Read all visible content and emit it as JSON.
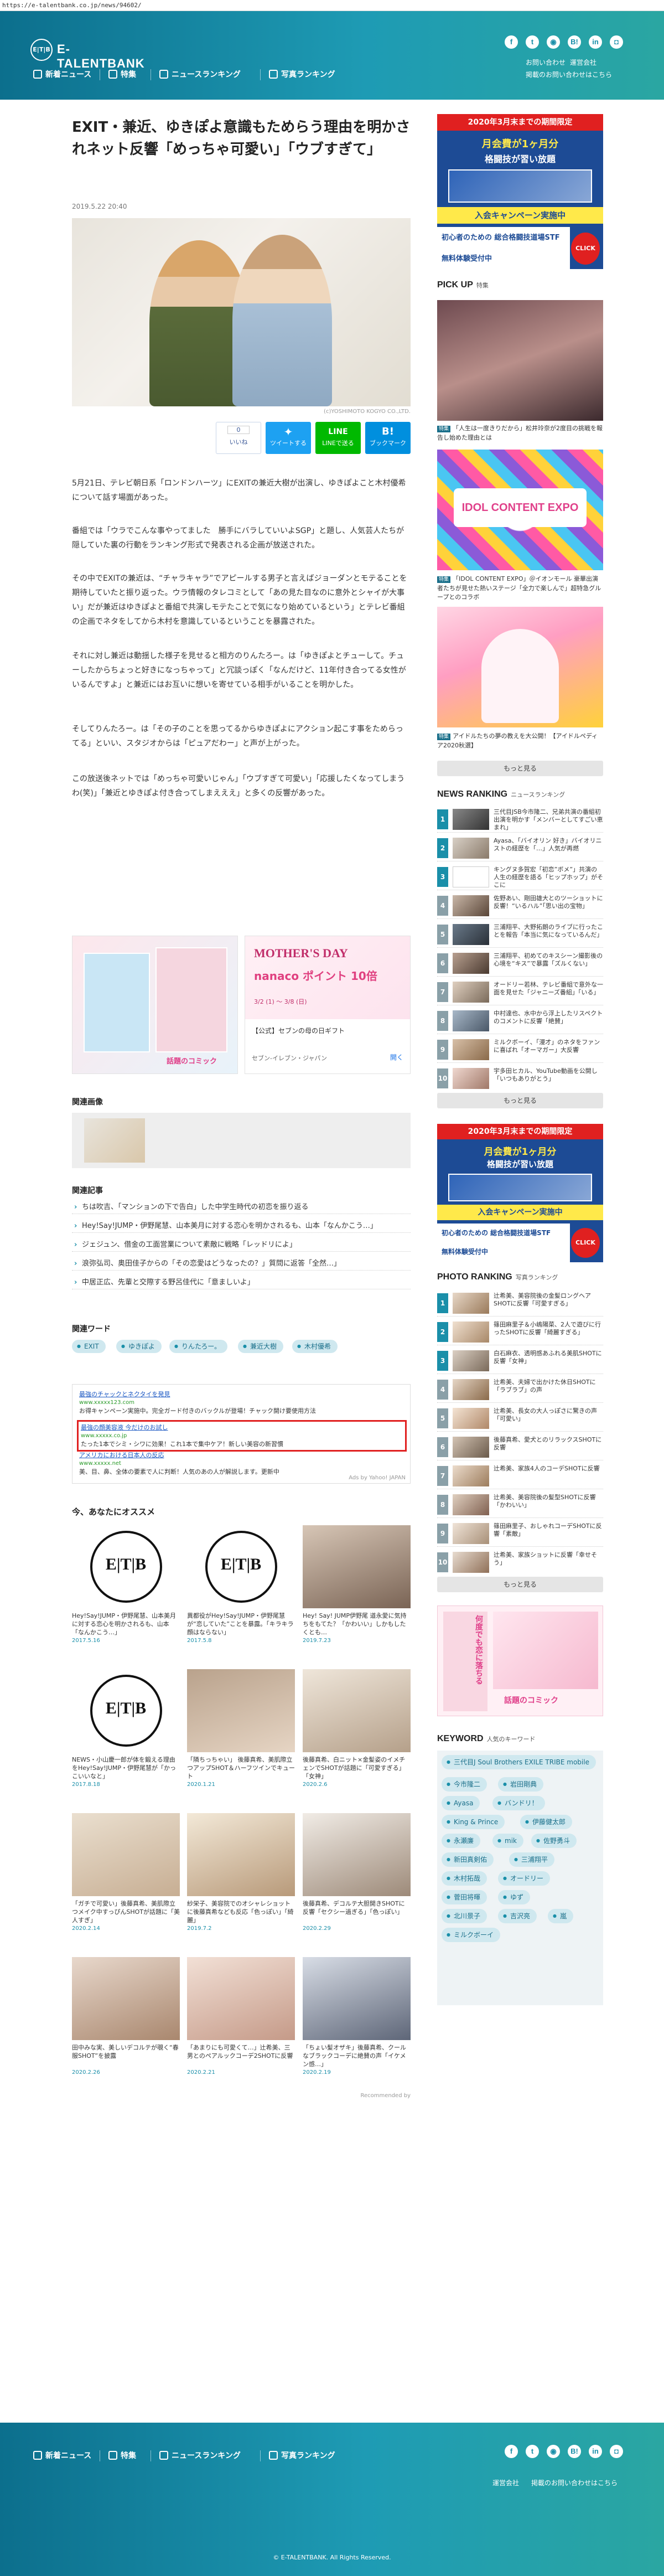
{
  "url": "https://e-talentbank.co.jp/news/94602/",
  "site": {
    "logo_text": "E-TALENTBANK",
    "logo_mark": "E|T|B"
  },
  "nav": [
    {
      "label": "新着ニュース",
      "icon": "news-icon"
    },
    {
      "label": "特集",
      "icon": "feature-icon"
    },
    {
      "label": "ニュースランキング",
      "icon": "ranking-icon"
    },
    {
      "label": "写真ランキング",
      "icon": "photo-icon"
    }
  ],
  "social": [
    "f",
    "t",
    "◉",
    "B!",
    "in",
    "◘"
  ],
  "header_links": {
    "top": [
      "お問い合わせ",
      "運営会社"
    ],
    "bottom": "掲載のお問い合わせはこちら"
  },
  "article": {
    "title": "EXIT・兼近、ゆきぽよ意識もためらう理由を明かされネット反響「めっちゃ可愛い」「ウブすぎて」",
    "date": "2019.5.22 20:40",
    "image_credit": "(c)YOSHIMOTO KOGYO CO.,LTD.",
    "share": [
      {
        "label": "いいね",
        "count": "0",
        "color": "#ffffff"
      },
      {
        "label": "ツイートする",
        "icon": "twitter-icon",
        "color": "#1da1f2"
      },
      {
        "label": "LINEで送る",
        "icon": "line-icon",
        "color": "#00b900"
      },
      {
        "label": "ブックマーク",
        "icon": "hatena-icon",
        "color": "#008fde"
      }
    ],
    "paragraphs": [
      "5月21日、テレビ朝日系「ロンドンハーツ」にEXITの兼近大樹が出演し、ゆきぽよこと木村優希について話す場面があった。",
      "番組では「ウラでこんな事やってました　勝手にバラしていいよSGP」と題し、人気芸人たちが隠していた裏の行動をランキング形式で発表される企画が放送された。",
      "その中でEXITの兼近は、“チャラキャラ”でアピールする男子と言えばジョーダンとモテることを期待していたと振り返った。ウラ情報のタレコミとして「あの見た目なのに意外とシャイが大事い」だが兼近はゆきぽよと番組で共演しモテたことで気になり始めているという」とテレビ番組の企画でネタをしてから木村を意識しているということを暴露された。",
      "それに対し兼近は動揺した様子を見せると相方のりんたろー。は「ゆきぽよとチューして。チューしたからちょっと好きになっちゃって」と冗談っぽく「なんだけど、11年付き合ってる女性がいるんですよ」と兼近にはお互いに想いを寄せている相手がいることを明かした。",
      "そしてりんたろー。は「その子のことを思ってるからゆきぽよにアクション起こす事をためらってる」といい、スタジオからは「ピュアだわー」と声が上がった。",
      "この放送後ネットでは「めっちゃ可愛いじゃん」「ウブすぎて可愛い」「応援したくなってしまうわ(笑)」「兼近とゆきぽよ付き合ってしまえええ」と多くの反響があった。"
    ]
  },
  "ads": [
    {
      "label": "漫画広告",
      "sub": "話題のコミック",
      "cta": ""
    },
    {
      "label": "MOTHER'S DAY",
      "sub": "nanaco ポイント 10倍",
      "small": "3/2 (1) ～ 3/8 (日)",
      "caption": "【公式】セブンの母の日ギフト",
      "cta": "開く",
      "source": "セブン-イレブン・ジャパン"
    }
  ],
  "related_images_title": "関連画像",
  "related_articles_title": "関連記事",
  "related_articles": [
    "ちは吹吉、「マンションの下で告白」した中学生時代の初恋を振り返る",
    "Hey!Say!JUMP・伊野尾慧、山本美月に対する恋心を明かされるも、山本「なんかこう…」",
    "ジェジュン、借金の工面営業について素敵に戦略「レッドリによ」",
    "浪弥弘司、奥田佳子からの「その恋愛はどうなったの？」質問に返答「全然…」",
    "中居正広、先輩と交際する野呂佳代に「意ましいよ」"
  ],
  "related_words_title": "関連ワード",
  "related_words": [
    "EXIT",
    "ゆきぽよ",
    "りんたろー。",
    "兼近大樹",
    "木村優希"
  ],
  "yahoo_ads": [
    {
      "title": "最強のチャックとネクタイを発見",
      "url": "www.xxxxx123.com",
      "desc": "お得キャンペーン実施中。完全ガード付きのバックルが登場！チャック開け要使用方法"
    },
    {
      "title": "最強の顔美容液 今だけのお試し",
      "url": "www.xxxxx.co.jp",
      "desc": "たった1本でシミ・シワに効果！これ1本で集中ケア！新しい美容の新習慣"
    },
    {
      "title": "アメリカにおける日本人の反応",
      "url": "www.xxxxx.net",
      "desc": "美、目、鼻、全体の要素で人に判断！人気のあの人が解説します。更新中"
    }
  ],
  "yahoo_label": "Ads by Yahoo! JAPAN",
  "recommend_title": "今、あなたにオススメ",
  "recommend": [
    {
      "caption": "Hey!Say!JUMP・伊野尾慧、山本美月に対する恋心を明かされるも、山本「なんかこう…」",
      "date": "2017.5.16",
      "logo": true
    },
    {
      "caption": "異都役がHey!Say!JUMP・伊野尾慧が“恋していた”ことを暴露。「キラキラ顔はならない」",
      "date": "2017.5.8",
      "logo": true
    },
    {
      "caption": "Hey! Say! JUMP伊野尾 道永愛に気持ちをもてた？「かわいい」しかもしたくとも…",
      "date": "2019.7.23",
      "logo": false
    },
    {
      "caption": "NEWS・小山慶一郎が体を鍛える理由をHey!Say!JUMP・伊野尾慧が「かっこいいなと」",
      "date": "2017.8.18",
      "logo": true
    },
    {
      "caption": "「隣ちっちゃい」 後藤真希、美肌際立つアップSHOT＆ハーフツインでキュート",
      "date": "2020.1.21",
      "logo": false
    },
    {
      "caption": "後藤真希、白ニット×金髪姿のイメチェンでSHOTが話題に「可愛すぎる」「女神」",
      "date": "2020.2.6",
      "logo": false
    },
    {
      "caption": "「ガチで可愛い」後藤真希、美肌際立つメイク中すっぴんSHOTが話題に「美人すぎ」",
      "date": "2020.2.14",
      "logo": false
    },
    {
      "caption": "紗栄子、美容院でのオシャレショットに後藤真希なども反応「色っぽい」「綺麗」",
      "date": "2019.7.2",
      "logo": false
    },
    {
      "caption": "後藤真希、デコルテ大胆開きSHOTに反響「セクシー過ぎる」「色っぽい」",
      "date": "2020.2.29",
      "logo": false
    },
    {
      "caption": "田中みな実、美しいデコルテが覗く“春服SHOT”を披露",
      "date": "2020.2.26",
      "logo": false
    },
    {
      "caption": "「あまりにも可愛くて…」辻希美、三男とのペアルックコーデ2SHOTに反響",
      "date": "2020.2.21",
      "logo": false
    },
    {
      "caption": "「ちょい髪オザキ」後藤真希、クールなブラックコーデに絶賛の声「イケメン感…」",
      "date": "2020.2.19",
      "logo": false
    }
  ],
  "recommend_footer": "Recommended by",
  "sidebar": {
    "banner_top": {
      "line1": "2020年3月末までの期間限定",
      "line2": "月会費が1ヶ月分",
      "line3": "格闘技が習い放題",
      "line4": "入会キャンペーン実施中",
      "line5": "初心者のための 総合格闘技道場STF",
      "line6": "無料体験受付中",
      "cta": "CLICK"
    },
    "pickup_title": "PICK UP",
    "pickup_sub": "特集",
    "pickup": [
      {
        "tag": "特集",
        "caption": "「人生は一度きりだから」松井玲奈が2度目の挑戦を報告し始めた理由とは"
      },
      {
        "tag": "特集",
        "caption": "「IDOL CONTENT EXPO」＠イオンモール 豪華出演者たちが見せた熱いステージ「全力で楽しんで」超特急グループとのコラボ"
      },
      {
        "tag": "特集",
        "caption": "アイドルたちの夢の教えを大公開！【アイドルペディア2020秋選】"
      }
    ],
    "more_label": "もっと見る",
    "ranking_title": "NEWS RANKING",
    "ranking_sub": "ニュースランキング",
    "ranking": [
      {
        "n": "1",
        "text": "三代目JSB今市隆二、兄弟共演の番組初出演を明かす「メンバーとしてすごい恵まれ」"
      },
      {
        "n": "2",
        "text": "Ayasa、「バイオリン 好き」バイオリニストの経歴を「…」人気が再燃"
      },
      {
        "n": "3",
        "text": "キングヌ多賀宏「初恋”ボメ”」共演の人生の経歴を語る「ヒップホップ」がそこに"
      },
      {
        "n": "4",
        "text": "佐野あい、剛田雄大とのツーショットに反響！“いるハル”「思い出の宝物」"
      },
      {
        "n": "5",
        "text": "三浦翔平、大野拓朗のライブに行ったことを報告「本当に気になっているんだ」"
      },
      {
        "n": "6",
        "text": "三浦翔平、初めてのキスシーン撮影後の心境を“キス”で暴露「ズルくない」"
      },
      {
        "n": "7",
        "text": "オードリー若林、テレビ番組で意外な一面を見せた「ジャニーズ番組」「いる」"
      },
      {
        "n": "8",
        "text": "中村達也、水中から浮上したリスペクトのコメントに反響「絶賛」"
      },
      {
        "n": "9",
        "text": "ミルクボーイ、「漫才」のネタをファンに喜ばれ「オーマガー」大反響"
      },
      {
        "n": "10",
        "text": "宇多田ヒカル、YouTube動画を公開し「いつもありがとう」"
      }
    ],
    "banner_mid": {
      "line1": "2020年3月末までの期間限定",
      "line2": "月会費が1ヶ月分",
      "line3": "格闘技が習い放題",
      "line4": "入会キャンペーン実施中",
      "line5": "初心者のための 総合格闘技道場STF",
      "line6": "無料体験受付中",
      "cta": "CLICK"
    },
    "photo_title": "PHOTO RANKING",
    "photo_sub": "写真ランキング",
    "photo_ranking": [
      {
        "n": "1",
        "text": "辻希美、美容院後の金髪ロングヘアSHOTに反響「可愛すぎる」"
      },
      {
        "n": "2",
        "text": "篠田麻里子＆小嶋陽菜、2人で遊びに行ったSHOTに反響「綺麗すぎる」"
      },
      {
        "n": "3",
        "text": "白石麻衣、透明感あふれる美肌SHOTに反響「女神」"
      },
      {
        "n": "4",
        "text": "辻希美、夫婦で出かけた休日SHOTに「ラブラブ」の声"
      },
      {
        "n": "5",
        "text": "辻希美、長女の大人っぽさに驚きの声「可愛い」"
      },
      {
        "n": "6",
        "text": "後藤真希、愛犬とのリラックスSHOTに反響"
      },
      {
        "n": "7",
        "text": "辻希美、家族4人のコーデSHOTに反響"
      },
      {
        "n": "8",
        "text": "辻希美、美容院後の髪型SHOTに反響「かわいい」"
      },
      {
        "n": "9",
        "text": "篠田麻里子、おしゃれコーデSHOTに反響「素敵」"
      },
      {
        "n": "10",
        "text": "辻希美、家族ショットに反響「幸せそう」"
      }
    ],
    "banner_bottom": {
      "line1": "何度でも恋に落ちる",
      "line2": "話題のコミック"
    },
    "keyword_title": "KEYWORD",
    "keyword_sub": "人気のキーワード",
    "keywords": [
      "三代目J Soul Brothers EXILE TRIBE mobile",
      "今市隆二",
      "岩田剛典",
      "Ayasa",
      "バンドリ！",
      "King & Prince",
      "伊藤健太郎",
      "永瀬廉",
      "mik",
      "佐野勇斗",
      "新田真剣佑",
      "三浦翔平",
      "木村拓哉",
      "オードリー",
      "菅田将暉",
      "ゆず",
      "北川景子",
      "吉沢亮",
      "嵐",
      "ミルクボーイ"
    ]
  },
  "footer": {
    "copyright": "© E-TALENTBANK. All Rights Reserved."
  },
  "colors": {
    "brand_teal": "#1a8fa9",
    "rank_gold": "#c9a24b",
    "rank_dark": "#8aa0a8",
    "accent_red": "#e02020"
  }
}
